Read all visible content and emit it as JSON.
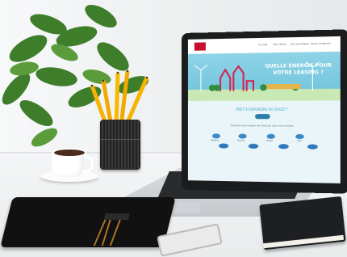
{
  "website": {
    "nav_links": [
      "Accueil",
      "Nos offres",
      "Vos avantages",
      "Nous contacter"
    ],
    "hero_title_line1": "QUELLE ÉNERGIE POUR",
    "hero_title_line2": "VOTRE LEASING ?",
    "question_title": "PRÊT À RÉPONDRE AU QUIZZ ?",
    "question_sub": "Sélectionnez le type de véhicule que vous utilisez",
    "vehicle_options": [
      "Citadine",
      "Berline",
      "Break",
      "SUV"
    ]
  },
  "colors": {
    "accent_red": "#c8102e",
    "hero_sky": "#8fd3e6",
    "link_blue": "#3aa7c9"
  }
}
